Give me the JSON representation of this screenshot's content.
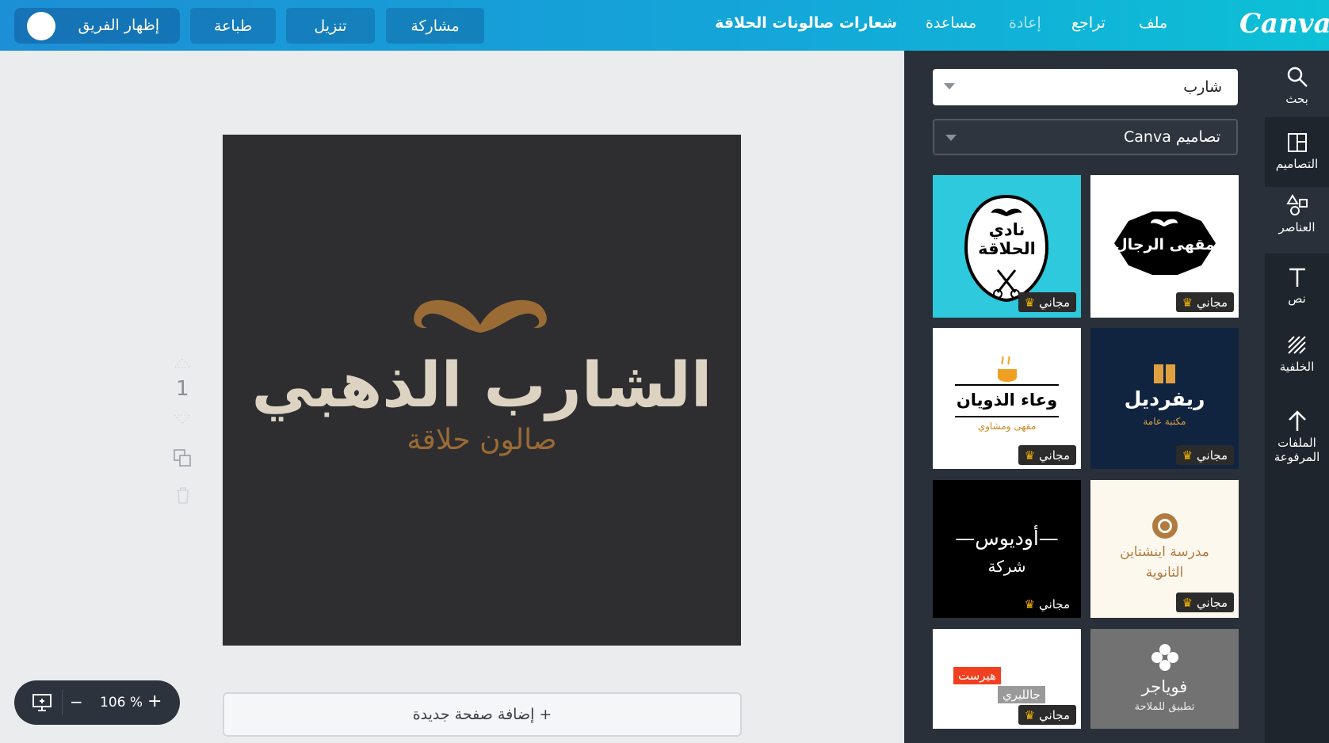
{
  "topbar": {
    "brand": "Canva",
    "menu": {
      "file": "ملف",
      "undo": "تراجع",
      "redo": "إعادة",
      "help": "مساعدة"
    },
    "design_title": "شعارات صالونات الحلاقة",
    "buttons": {
      "share": "مشاركة",
      "download": "تنزيل",
      "print": "طباعة"
    },
    "team_toggle": "إظهار الفريق"
  },
  "canvas": {
    "design_title_text": "الشارب الذهبي",
    "design_subtitle_text": "صالون حلاقة",
    "page_number": "1",
    "add_page": "+ إضافة صفحة جديدة",
    "zoom_level": "106 %",
    "zoom_minus": "−",
    "zoom_plus": "+"
  },
  "search_panel": {
    "query": "شارب",
    "filter": "تصاميم Canva",
    "badge_label": "مجاني",
    "templates": [
      {
        "line1": "نادي",
        "line2": "الحلاقة",
        "bg": "#2ec9dc"
      },
      {
        "line1": "\"مقهى الرجال\"",
        "bg": "#ffffff"
      },
      {
        "line1": "وعاء الذويان",
        "line2": "مقهى ومشاوي",
        "bg": "#ffffff"
      },
      {
        "line1": "ريفرديل",
        "line2": "مكتبة عامة",
        "bg": "#102440"
      },
      {
        "line1": "—أوديوس—",
        "line2": "شركة",
        "bg": "#000000"
      },
      {
        "line1": "مدرسة اينشتاين",
        "line2": "الثانوية",
        "bg": "#fcf8ee"
      },
      {
        "line1": "هيرست",
        "line2": "جالليري",
        "bg": "#ffffff"
      },
      {
        "line1": "فوياجر",
        "line2": "تطبيق للملاحة",
        "bg": "#727272"
      }
    ]
  },
  "sidebar": {
    "items": [
      "بحث",
      "التصاميم",
      "العناصر",
      "نص",
      "الخلفية",
      "الملفات المرفوعة"
    ]
  },
  "colors": {
    "accent": "#14a5d8",
    "panel": "#293039",
    "canvas_bg": "#2e2e30",
    "logo_gold": "#9a6b35"
  }
}
